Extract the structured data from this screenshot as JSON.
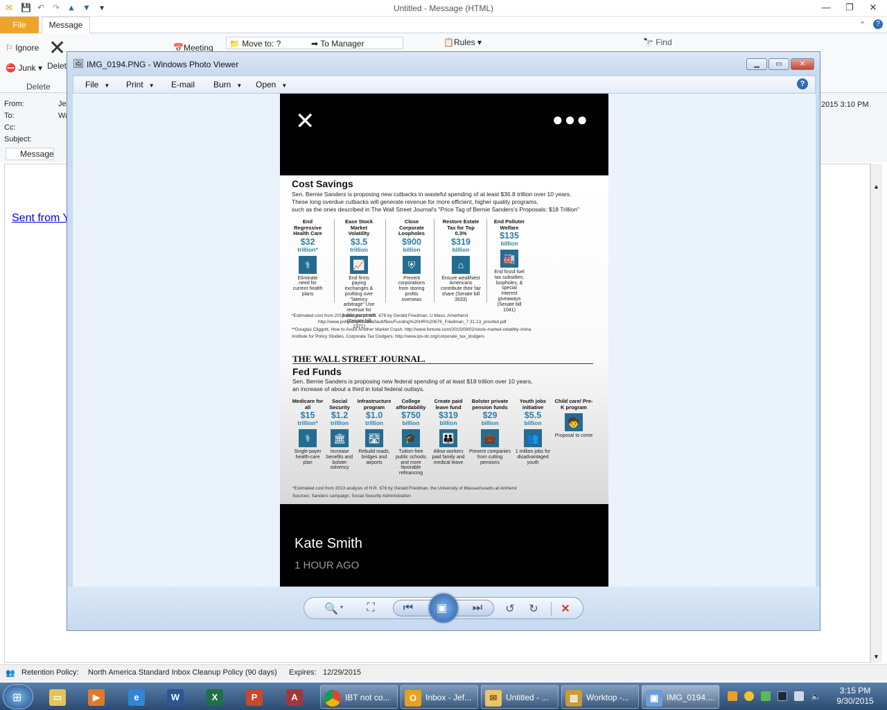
{
  "outlook": {
    "window_title": "Untitled  -  Message (HTML)",
    "tabs": {
      "file": "File",
      "message": "Message"
    },
    "ribbon": {
      "ignore": "Ignore",
      "junk": "Junk",
      "delete": "Delet",
      "group_delete": "Delete",
      "meeting": "Meeting",
      "move_to": "Move to: ?",
      "to_manager": "To Manager",
      "rules": "Rules",
      "find": "Find"
    },
    "header": {
      "from_label": "From:",
      "from_value": "Je",
      "to_label": "To:",
      "to_value": "Wa",
      "cc_label": "Cc:",
      "subject_label": "Subject:",
      "sent_fragment": "2015 3:10 PM",
      "message_tab": "Message"
    },
    "body_text": "Sent from Y",
    "status": {
      "retention_label": "Retention Policy:",
      "retention_value": "North America Standard Inbox Cleanup Policy (90 days)",
      "expires_label": "Expires:",
      "expires_value": "12/29/2015"
    }
  },
  "viewer": {
    "title": "IMG_0194.PNG - Windows Photo Viewer",
    "menu": {
      "file": "File",
      "print": "Print",
      "email": "E-mail",
      "burn": "Burn",
      "open": "Open"
    },
    "help": "?"
  },
  "image": {
    "cost": {
      "title": "Cost Savings",
      "intro": [
        "Sen. Bernie Sanders is proposing new cutbacks in wasteful spending of at least $36.8 trillion over 10 years.",
        "These long overdue cutbacks will generate revenue for more efficient, higher quality programs,",
        "such as the ones described in The Wall Street Journal's \"Price Tag of Bernie Sanders's Proposals: $18 Trillion\""
      ],
      "items": [
        {
          "head": "End Regressive Health Care",
          "value": "$32",
          "unit": "trillion*",
          "icon": "caduceus-icon",
          "desc": "Eliminate need for current health plans"
        },
        {
          "head": "Ease Stock Market Volatility",
          "value": "$3.5",
          "unit": "trillion",
          "icon": "stock-chart-icon",
          "desc": "End firms paying exchanges & profiting over \"latency arbitrage\" Use revenue for public purposes (Senate bill 1371)"
        },
        {
          "head": "Close Corporate Loopholes",
          "value": "$900",
          "unit": "billion",
          "icon": "shield-icon",
          "desc": "Prevent corporations from storing profits overseas"
        },
        {
          "head": "Restore Estate Tax for Top 0.3%",
          "value": "$319",
          "unit": "billion",
          "icon": "house-icon",
          "desc": "Ensure wealthiest Americans contribute their fair share (Senate bill 3533)"
        },
        {
          "head": "End Polluter Welfare",
          "value": "$135",
          "unit": "billion",
          "icon": "factory-icon",
          "desc": "End fossil fuel tax subsidies, loopholes, & special interest giveaways (Senate bill 1041)"
        }
      ],
      "footnotes": [
        "*Estimated cost from 2013 analysis of H.R. 676 by Gerald Friedman, U Mass, Amerherst",
        "http://www.pnhp.org/sites/default/files/Funding%20HR%20676_Friedman_7.31.13_proofed.pdf",
        "**Douglas Cliggott, How to Avoid Another Market Crash. http://www.fortune.com/2015/09/02/stock-market-volatility-china",
        "Institute for Policy Studies, Corporate Tax Dodgers. http://www.ips-dc.org/corporate_tax_dodgers"
      ]
    },
    "wsj": {
      "masthead": "THE WALL STREET JOURNAL.",
      "title": "Fed Funds",
      "intro": [
        "Sen. Bernie Sanders is proposing new federal spending of at least $18 trillion over 10 years,",
        "an increase of about a third in total federal outlays."
      ],
      "items": [
        {
          "head": "Medicare for all",
          "value": "$15",
          "unit": "trillion*",
          "icon": "caduceus-icon",
          "desc": "Single-payer health-care plan"
        },
        {
          "head": "Social Security",
          "value": "$1.2",
          "unit": "trillion",
          "icon": "building-icon",
          "desc": "Increase benefits and bolster solvency"
        },
        {
          "head": "Infrastructure program",
          "value": "$1.0",
          "unit": "trillion",
          "icon": "road-icon",
          "desc": "Rebuild roads, bridges and airports"
        },
        {
          "head": "College affordability",
          "value": "$750",
          "unit": "billion",
          "icon": "graduation-cap-icon",
          "desc": "Tuition-free public schools and more favorable refinancing"
        },
        {
          "head": "Create paid leave fund",
          "value": "$319",
          "unit": "billion",
          "icon": "family-icon",
          "desc": "Allow workers paid family and medical leave"
        },
        {
          "head": "Bolster private pension funds",
          "value": "$29",
          "unit": "billion",
          "icon": "pension-icon",
          "desc": "Prevent companies from cutting pensions"
        },
        {
          "head": "Youth jobs initiative",
          "value": "$5.5",
          "unit": "billion",
          "icon": "people-icon",
          "desc": "1 million jobs for disadvantaged youth"
        },
        {
          "head": "Child care/ Pre-K program",
          "value": "",
          "unit": "",
          "icon": "child-icon",
          "desc": "Proposal to come"
        }
      ],
      "footnotes": [
        "*Estimated cost from 2013 analysis of H.R. 676 by Gerald Friedman, the University of Massachusetts at Amherst",
        "Sources: Sanders campaign; Social Security Administration"
      ]
    },
    "caption": {
      "name": "Kate Smith",
      "time": "1 HOUR AGO"
    }
  },
  "taskbar": {
    "items": [
      {
        "label": "IBT not co...",
        "icon": "chrome-icon"
      },
      {
        "label": "Inbox - Jef...",
        "icon": "outlook-icon"
      },
      {
        "label": "Untitled - ...",
        "icon": "envelope-icon"
      },
      {
        "label": "Worktop -...",
        "icon": "worktop-icon"
      },
      {
        "label": "IMG_0194....",
        "icon": "photo-viewer-icon"
      }
    ],
    "clock_time": "3:15 PM",
    "clock_date": "9/30/2015"
  }
}
